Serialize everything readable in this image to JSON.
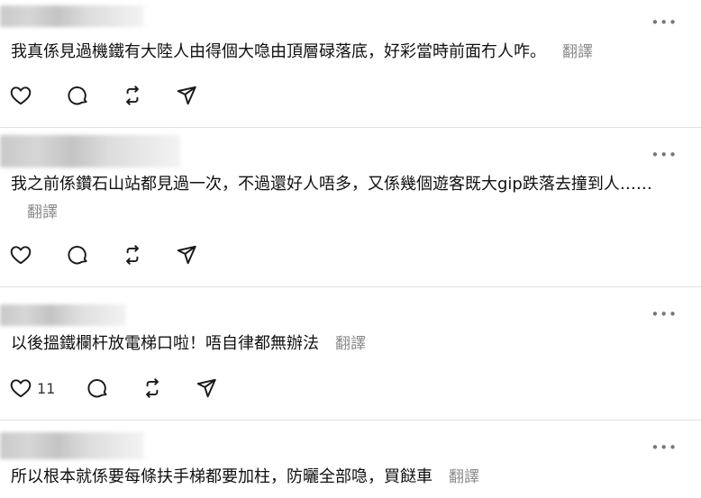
{
  "posts": [
    {
      "text": "我真係見過機鐵有大陸人由得個大喼由頂層碌落底，好彩當時前面冇人咋。",
      "translate": "翻譯",
      "more": "•••",
      "like_count": ""
    },
    {
      "text": "我之前係鑽石山站都見過一次，不過還好人唔多，又係幾個遊客既大gip跌落去撞到人……",
      "translate": "翻譯",
      "more": "•••",
      "like_count": ""
    },
    {
      "text": "以後搵鐵欄杆放電梯口啦！唔自律都無辦法",
      "translate": "翻譯",
      "more": "•••",
      "like_count": "11"
    },
    {
      "text": "所以根本就係要每條扶手梯都要加柱，防曬全部喼，買餸車",
      "translate": "翻譯",
      "more": "•••",
      "like_count": ""
    }
  ],
  "icons": [
    "heart-icon",
    "comment-icon",
    "repost-icon",
    "share-icon"
  ],
  "colors": {
    "text": "#101010",
    "muted": "#8a8a8a",
    "divider": "#e3e3e3"
  }
}
